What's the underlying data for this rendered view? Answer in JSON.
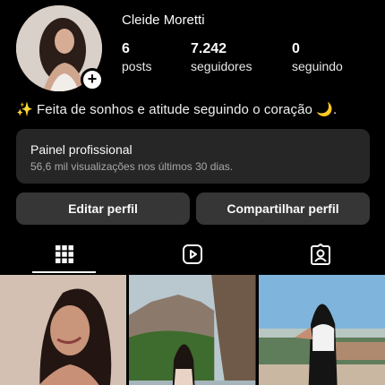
{
  "profile": {
    "username": "Cleide Moretti",
    "add_icon": "plus-icon"
  },
  "stats": [
    {
      "value": "6",
      "label": "posts"
    },
    {
      "value": "7.242",
      "label": "seguidores"
    },
    {
      "value": "0",
      "label": "seguindo"
    }
  ],
  "bio": "✨ Feita de sonhos e atitude seguindo o coração 🌙.",
  "pro_panel": {
    "title": "Painel profissional",
    "subtitle": "56,6 mil visualizações nos últimos 30 dias."
  },
  "buttons": {
    "edit": "Editar perfil",
    "share": "Compartilhar perfil"
  },
  "tabs": [
    {
      "icon": "grid-icon",
      "active": true
    },
    {
      "icon": "reels-icon",
      "active": false
    },
    {
      "icon": "tagged-icon",
      "active": false
    }
  ],
  "posts": [
    {
      "description_icon": "photo-portrait"
    },
    {
      "description_icon": "photo-landscape"
    },
    {
      "description_icon": "photo-outdoor"
    }
  ]
}
